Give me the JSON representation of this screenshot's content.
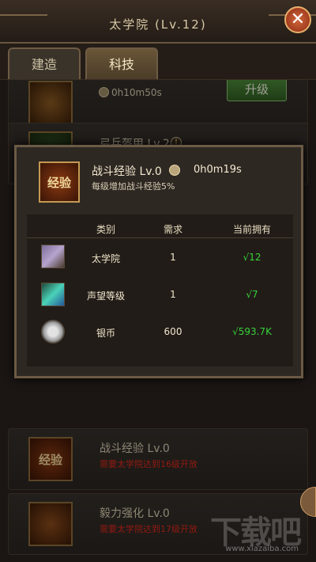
{
  "header": {
    "title": "太学院",
    "level": "(Lv.12)"
  },
  "tabs": [
    {
      "label": "建造"
    },
    {
      "label": "科技"
    }
  ],
  "list": {
    "rows": [
      {
        "time": "0h10m50s",
        "button": "升级"
      },
      {
        "title": "弓兵盔甲 Lv.2"
      },
      {
        "title": "战斗经验 Lv.0",
        "req": "需要太学院达到16级开放"
      },
      {
        "title": "毅力强化 Lv.0",
        "req": "需要太学院达到17级开放"
      }
    ]
  },
  "popup": {
    "icon_text": "经验",
    "title": "战斗经验 Lv.0",
    "time": "0h0m19s",
    "desc": "每级增加战斗经验5%",
    "table": {
      "headers": [
        "类别",
        "需求",
        "当前拥有"
      ],
      "rows": [
        {
          "name": "太学院",
          "need": "1",
          "have": "√12"
        },
        {
          "name": "声望等级",
          "need": "1",
          "have": "√7"
        },
        {
          "name": "银币",
          "need": "600",
          "have": "√593.7K"
        }
      ]
    }
  },
  "list_icon_text": "经验",
  "watermark": {
    "text": "下载吧",
    "url": "www.xiazaiba.com"
  }
}
